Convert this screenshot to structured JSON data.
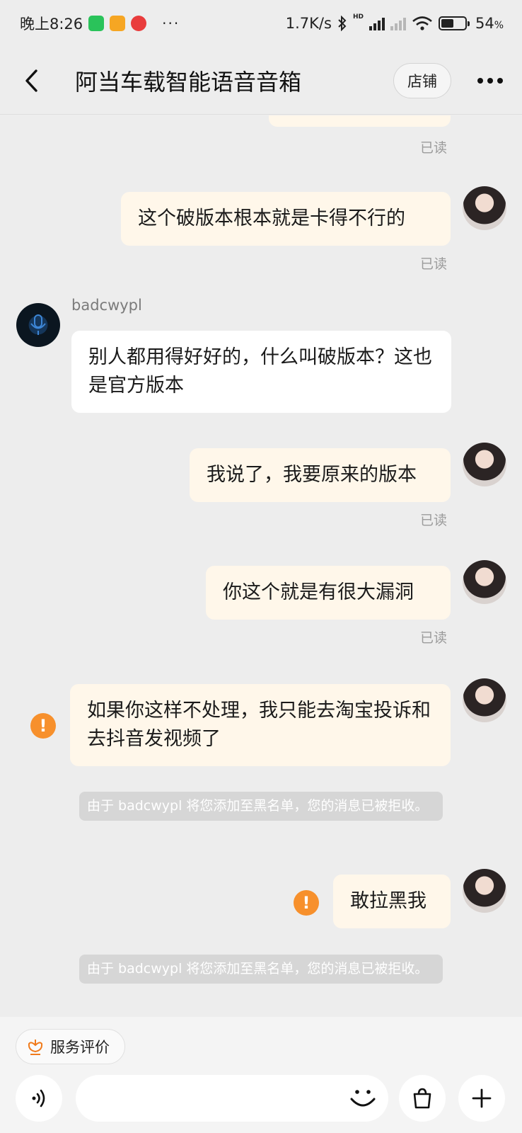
{
  "status_bar": {
    "time": "晚上8:26",
    "more": "···",
    "network_speed": "1.7K/s",
    "hd_label": "HD",
    "battery_percent": "54",
    "percent_sign": "%",
    "battery_level": 0.54
  },
  "header": {
    "title": "阿当车载智能语音音箱",
    "shop_label": "店铺"
  },
  "chat": {
    "read_label": "已读",
    "shop_name": "badcwypl",
    "messages": [
      {
        "text": "这个破版本根本就是卡得不行的"
      },
      {
        "text": "别人都用得好好的，什么叫破版本？这也是官方版本"
      },
      {
        "text": "我说了，我要原来的版本"
      },
      {
        "text": "你这个就是有很大漏洞"
      },
      {
        "text": "如果你这样不处理，我只能去淘宝投诉和去抖音发视频了"
      },
      {
        "text": "敢拉黑我"
      }
    ],
    "system_notice": "由于 badcwypl 将您添加至黑名单，您的消息已被拒收。"
  },
  "bottom": {
    "review_label": "服务评价",
    "input_value": ""
  },
  "colors": {
    "outgoing_bubble": "#fff7ea",
    "incoming_bubble": "#ffffff",
    "warning": "#f7902c",
    "background": "#ededed"
  }
}
